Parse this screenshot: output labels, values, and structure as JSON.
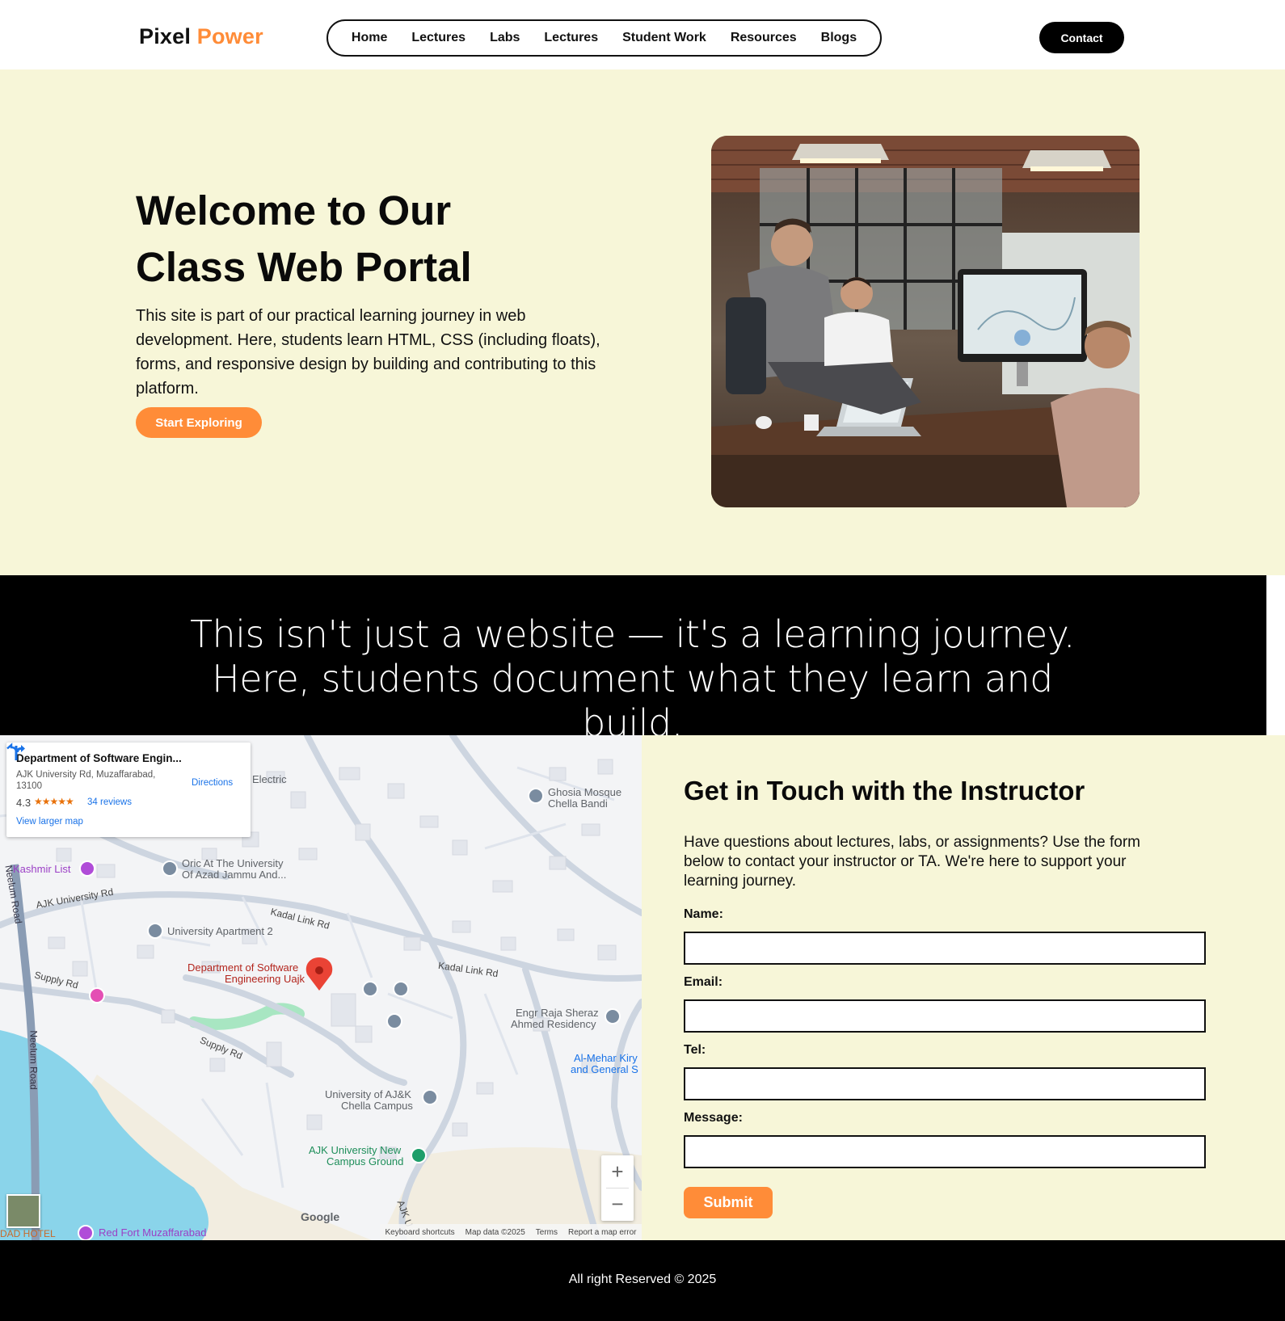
{
  "brand": {
    "part1": "Pixel",
    "part2": "Power",
    "accent": "#ff8c38"
  },
  "nav": {
    "items": [
      "Home",
      "Lectures",
      "Labs",
      "Lectures",
      "Student Work",
      "Resources",
      "Blogs"
    ]
  },
  "header": {
    "contact_label": "Contact"
  },
  "hero": {
    "title_line1": "Welcome to Our",
    "title_line2": "Class Web Portal",
    "text": "This site is part of our practical learning journey in web development. Here, students learn HTML, CSS (including floats), forms, and responsive design by building and contributing to this platform.",
    "button": "Start Exploring",
    "image": "team-meeting-photo"
  },
  "banner": {
    "quote": "This isn't just a website — it's a learning journey. Here, students document what they learn and build."
  },
  "map": {
    "card": {
      "title": "Department of Software Engin...",
      "address": "AJK University Rd, Muzaffarabad, 13100",
      "rating": "4.3",
      "stars": "★★★★★",
      "reviews": "34 reviews",
      "larger": "View larger map",
      "directions": "Directions"
    },
    "labels": {
      "electric": "Electric",
      "ghosia1": "Ghosia Mosque",
      "ghosia2": "Chella Bandi",
      "kashmir": "Kashmir List",
      "oric1": "Oric At The University",
      "oric2": "Of Azad Jammu And...",
      "ajk_rd": "AJK University Rd",
      "kadal1": "Kadal Link Rd",
      "kadal2": "Kadal Link Rd",
      "uni_apt": "University Apartment 2",
      "dept1": "Department of Software",
      "dept2": "Engineering Uajk",
      "supply1": "Supply Rd",
      "supply2": "Supply Rd",
      "neelum1": "Neelum Road",
      "neelum2": "Neelum Road",
      "engr1": "Engr Raja Sheraz",
      "engr2": "Ahmed Residency",
      "almehar1": "Al-Mehar Kiry",
      "almehar2": "and General S",
      "chella1": "University of AJ&K",
      "chella2": "Chella Campus",
      "ground1": "AJK University New",
      "ground2": "Campus Ground",
      "hotel": "DAD HOTEL",
      "redfort": "Red Fort Muzaffarabad",
      "ajku": "AJK U",
      "google": "Google"
    },
    "zoom_in": "+",
    "zoom_out": "−",
    "footer": {
      "shortcuts": "Keyboard shortcuts",
      "data": "Map data ©2025",
      "terms": "Terms",
      "report": "Report a map error"
    }
  },
  "contact_form": {
    "title": "Get in Touch with the Instructor",
    "description": "Have questions about lectures, labs, or assignments? Use the form below to contact your instructor or TA. We're here to support your learning journey.",
    "name_label": "Name:",
    "email_label": "Email:",
    "tel_label": "Tel:",
    "message_label": "Message:",
    "submit": "Submit"
  },
  "footer": {
    "text": "All right Reserved © 2025"
  }
}
